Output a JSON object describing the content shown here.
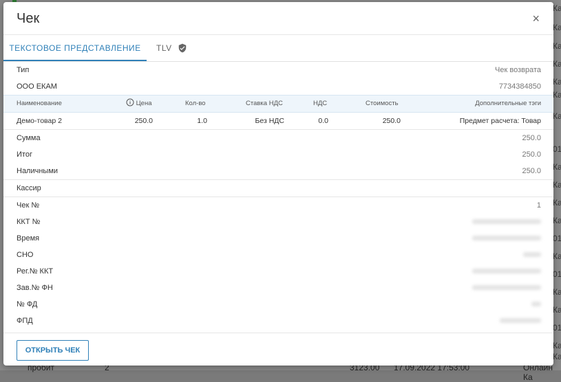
{
  "background": {
    "right_edge": [
      "Ка",
      "Ка",
      "Ка",
      "Ка",
      "Ка",
      "Ка",
      "Ка",
      "01",
      "Ка",
      "Ка",
      "Ка",
      "Ка",
      "01",
      "Ка",
      "01",
      "Ка",
      "Ка",
      "01",
      "Ка",
      "Ка"
    ],
    "bottom_row": {
      "name": "пробит",
      "count": "2",
      "amount": "3123.00",
      "datetime": "17.09.2022 17:53:00",
      "type": "Онлайн Ка"
    }
  },
  "dialog": {
    "title": "Чек",
    "close_glyph": "×",
    "tabs": {
      "text": "ТЕКСТОВОЕ ПРЕДСТАВЛЕНИЕ",
      "tlv": "TLV"
    },
    "header_rows": [
      {
        "label": "Тип",
        "value": "Чек возврата"
      },
      {
        "label": "ООО ЕКАМ",
        "value": "7734384850"
      }
    ],
    "table": {
      "columns": {
        "name": "Наименование",
        "price": "Цена",
        "qty": "Кол-во",
        "vat_rate": "Ставка НДС",
        "vat": "НДС",
        "cost": "Стоимость",
        "extra": "Дополнительные тэги"
      },
      "row": {
        "name": "Демо-товар 2",
        "price": "250.0",
        "qty": "1.0",
        "vat_rate": "Без НДС",
        "vat": "0.0",
        "cost": "250.0",
        "extra": "Предмет расчета: Товар"
      }
    },
    "totals": [
      {
        "label": "Сумма",
        "value": "250.0"
      },
      {
        "label": "Итог",
        "value": "250.0"
      },
      {
        "label": "Наличными",
        "value": "250.0"
      }
    ],
    "cashier_label": "Кассир",
    "details": [
      {
        "label": "Чек №",
        "value": "1"
      },
      {
        "label": "ККТ №",
        "value": ""
      },
      {
        "label": "Время",
        "value": ""
      },
      {
        "label": "СНО",
        "value": ""
      },
      {
        "label": "Рег.№ ККТ",
        "value": ""
      },
      {
        "label": "Зав.№ ФН",
        "value": ""
      },
      {
        "label": "№ ФД",
        "value": ""
      },
      {
        "label": "ФПД",
        "value": ""
      }
    ],
    "footer": {
      "open_button": "ОТКРЫТЬ ЧЕК"
    }
  },
  "colors": {
    "accent": "#2f80b8",
    "table_header_bg": "#eef5fb",
    "overlay": "#8a8a8a"
  },
  "icons": {
    "tlv": "verified-shield-icon",
    "price_info": "info-circle-icon",
    "close": "close-icon"
  }
}
